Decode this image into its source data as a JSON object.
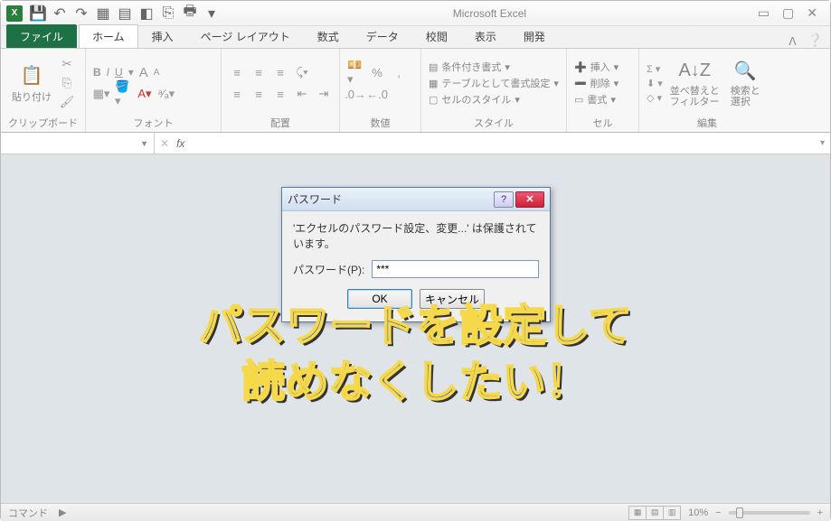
{
  "app_title": "Microsoft Excel",
  "tabs": {
    "file": "ファイル",
    "home": "ホーム",
    "insert": "挿入",
    "page_layout": "ページ レイアウト",
    "formulas": "数式",
    "data": "データ",
    "review": "校閲",
    "view": "表示",
    "developer": "開発"
  },
  "ribbon": {
    "clipboard": {
      "label": "クリップボード",
      "paste": "貼り付け"
    },
    "font": {
      "label": "フォント",
      "buttons": {
        "bold": "B",
        "italic": "I",
        "underline": "U",
        "grow": "A",
        "shrink": "A"
      }
    },
    "alignment": {
      "label": "配置"
    },
    "number": {
      "label": "数値"
    },
    "styles": {
      "label": "スタイル",
      "conditional": "条件付き書式",
      "table": "テーブルとして書式設定",
      "cell": "セルのスタイル"
    },
    "cells": {
      "label": "セル",
      "insert": "挿入",
      "delete": "削除",
      "format": "書式"
    },
    "editing": {
      "label": "編集",
      "sort": "並べ替えと\nフィルター",
      "find": "検索と\n選択"
    }
  },
  "formula_bar": {
    "name_box": "",
    "fx": "fx",
    "formula": ""
  },
  "dialog": {
    "title": "パスワード",
    "message": "'エクセルのパスワード設定、変更...' は保護されています。",
    "field_label": "パスワード(P):",
    "password_value": "***",
    "ok": "OK",
    "cancel": "キャンセル"
  },
  "overlay": {
    "line1": "パスワードを設定して",
    "line2": "読めなくしたい！"
  },
  "statusbar": {
    "command": "コマンド",
    "zoom": "10%"
  }
}
